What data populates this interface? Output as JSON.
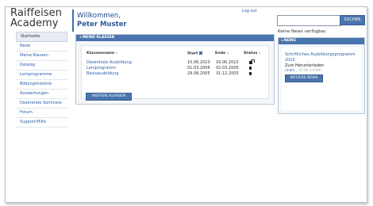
{
  "brand": {
    "line1": "Raiffeisen",
    "line2": "Academy"
  },
  "header": {
    "welcome": "Willkommen,",
    "user_name": "Peter Muster",
    "logout": "Log out"
  },
  "search": {
    "placeholder": "",
    "button": "SUCHEN"
  },
  "news_status": "Keine News verfügbar.",
  "sidebar": {
    "items": [
      {
        "label": "Startseite",
        "active": true
      },
      {
        "label": "News"
      },
      {
        "label": "Meine Klassen"
      },
      {
        "label": "Katalog"
      },
      {
        "label": "Lernprogramme"
      },
      {
        "label": "Bildungshistorie"
      },
      {
        "label": "Auswertungen"
      },
      {
        "label": "Dezentrale Seminare"
      },
      {
        "label": "Forum"
      },
      {
        "label": "Support/Hilfe"
      }
    ]
  },
  "classes": {
    "title": "MEINE KLASSEN",
    "columns": {
      "name": "Klassenname",
      "start": "Start",
      "end": "Ende",
      "status": "Status"
    },
    "rows": [
      {
        "name": "Dezentrale Ausbildung",
        "start": "10.06.2010",
        "end": "16.06.2010",
        "status_icon": "unlock-icon"
      },
      {
        "name": "Lernprogramm",
        "start": "01.03.2006",
        "end": "02.03.2006",
        "status_icon": "lock-icon"
      },
      {
        "name": "Basisausbildung",
        "start": "29.08.2005",
        "end": "31.12.2005",
        "status_icon": "lock-icon"
      }
    ],
    "more_button": "WEITERE KLASSEN"
  },
  "news": {
    "title": "NEWS",
    "item_title": "Schriftliches Ausbildungsprogramm 2010",
    "item_desc": "Zum Herunterladen",
    "item_link": "(mehr...",
    "item_meta": "27.05.2.9.09)",
    "more_button": "WEITERE NEWS"
  },
  "colors": {
    "accent": "#4a74ad",
    "link": "#2a5ea8",
    "panel_bg": "#f4f7fa"
  }
}
